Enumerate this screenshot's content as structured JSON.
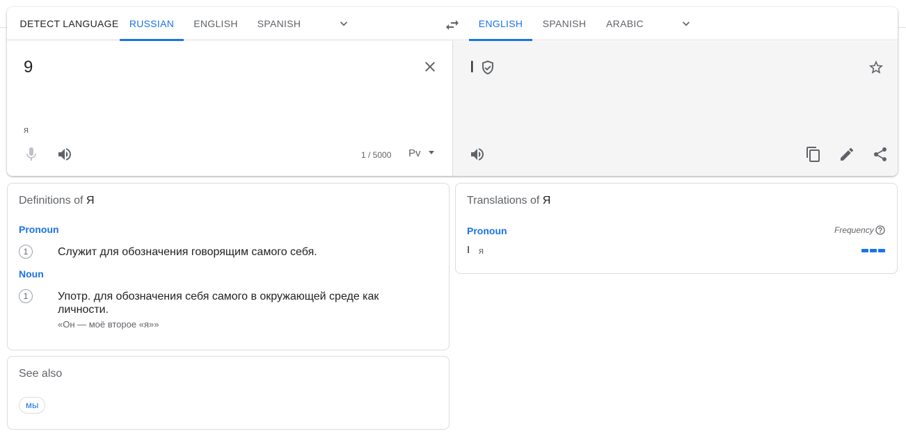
{
  "source_langs": {
    "tabs": [
      "DETECT LANGUAGE",
      "RUSSIAN",
      "ENGLISH",
      "SPANISH"
    ],
    "active": "RUSSIAN",
    "more_icon": "chevron-down-icon"
  },
  "swap_icon": "swap-arrows-icon",
  "target_langs": {
    "tabs": [
      "ENGLISH",
      "SPANISH",
      "ARABIC"
    ],
    "active": "ENGLISH",
    "more_icon": "chevron-down-icon"
  },
  "source": {
    "text": "9",
    "transliteration": "я",
    "char_count": "1 / 5000",
    "keyboard_label": "Рv",
    "icons": [
      "close-icon",
      "microphone-icon",
      "speaker-icon",
      "keyboard-icon"
    ]
  },
  "target": {
    "text": "I",
    "icons": [
      "verified-shield-icon",
      "star-icon",
      "speaker-icon",
      "copy-icon",
      "edit-icon",
      "share-icon"
    ]
  },
  "definitions": {
    "title_prefix": "Definitions of",
    "word": "Я",
    "groups": [
      {
        "pos": "Pronoun",
        "entries": [
          {
            "num": "1",
            "text": "Служит для обозначения говорящим самого себя.",
            "example": ""
          }
        ]
      },
      {
        "pos": "Noun",
        "entries": [
          {
            "num": "1",
            "text": "Употр. для обозначения себя самого в окружающей среде как личности.",
            "example": "«Он — моё второе «я»»"
          }
        ]
      }
    ]
  },
  "translations": {
    "title_prefix": "Translations of",
    "word": "Я",
    "pos": "Pronoun",
    "frequency_label": "Frequency",
    "rows": [
      {
        "word": "I",
        "back": "я",
        "frequency": 3
      }
    ]
  },
  "see_also": {
    "title": "See also",
    "chips": [
      "мы"
    ]
  },
  "colors": {
    "accent": "#1a73e8",
    "text": "#202124",
    "muted": "#5f6368",
    "border": "#dadce0",
    "target_bg": "#f5f5f5"
  }
}
